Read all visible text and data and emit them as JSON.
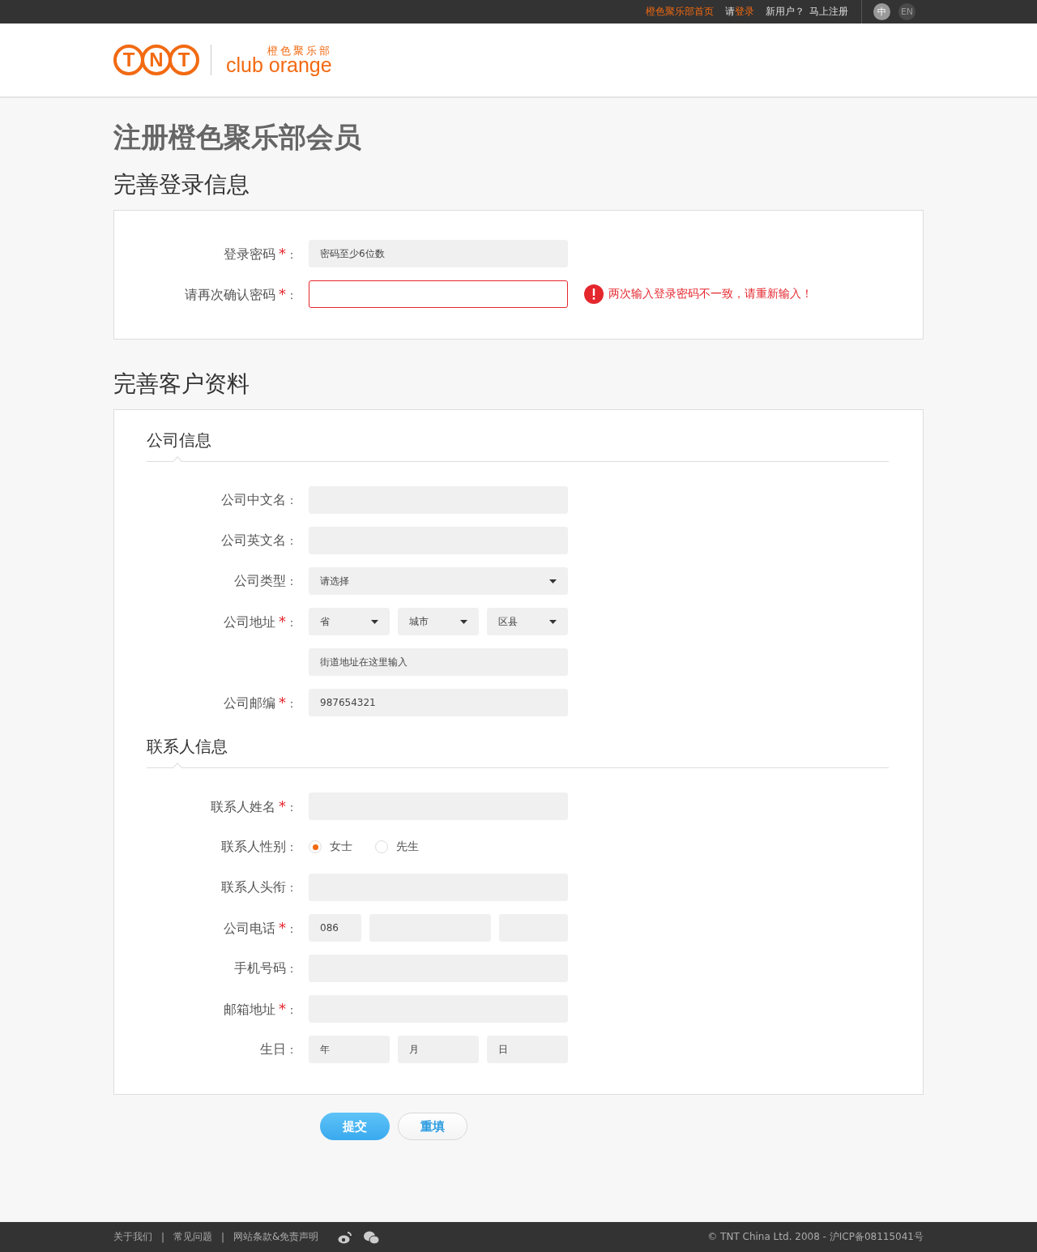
{
  "top_bar": {
    "home_link": "橙色聚乐部首页",
    "login_prompt": "请",
    "login_link": "登录",
    "new_user": "新用户？",
    "register_link": "马上注册",
    "languages": [
      {
        "label": "中",
        "selected": true
      },
      {
        "label": "EN",
        "selected": false
      }
    ]
  },
  "logo": {
    "letters": [
      "T",
      "N",
      "T"
    ],
    "club_cn": "橙色聚乐部",
    "club_en": "club orange"
  },
  "page_title": "注册橙色聚乐部会员",
  "form": {
    "required_mark": "*",
    "colon": "："
  },
  "sections": [
    {
      "title": "完善登录信息",
      "groups": [
        {
          "rows": [
            {
              "kind": "text",
              "label": "登录密码",
              "required": true,
              "fields": [
                {
                  "kind": "text",
                  "placeholder": "密码至少6位数",
                  "invalid": false
                }
              ]
            },
            {
              "kind": "text",
              "label": "请再次确认密码",
              "required": true,
              "fields": [
                {
                  "kind": "text",
                  "invalid": true
                }
              ],
              "error": "两次输入登录密码不一致，请重新输入！"
            }
          ]
        }
      ]
    },
    {
      "title": "完善客户资料",
      "groups": [
        {
          "title": "公司信息",
          "rows": [
            {
              "kind": "text",
              "label": "公司中文名",
              "required": false,
              "fields": [
                {
                  "kind": "text",
                  "invalid": false
                }
              ]
            },
            {
              "kind": "text",
              "label": "公司英文名",
              "required": false,
              "fields": [
                {
                  "kind": "text",
                  "invalid": false
                }
              ]
            },
            {
              "kind": "text",
              "label": "公司类型",
              "required": false,
              "fields": [
                {
                  "kind": "select",
                  "placeholder": "请选择",
                  "invalid": false
                }
              ]
            },
            {
              "kind": "triple",
              "label": "公司地址",
              "required": true,
              "fields": [
                {
                  "kind": "select",
                  "placeholder": "省",
                  "invalid": false
                },
                {
                  "kind": "select",
                  "placeholder": "城市",
                  "invalid": false
                },
                {
                  "kind": "select",
                  "placeholder": "区县",
                  "invalid": false
                }
              ]
            },
            {
              "kind": "text",
              "required": false,
              "fields": [
                {
                  "kind": "text",
                  "placeholder": "街道地址在这里输入",
                  "invalid": false
                }
              ]
            },
            {
              "kind": "text",
              "label": "公司邮编",
              "required": true,
              "fields": [
                {
                  "kind": "text",
                  "placeholder": "987654321",
                  "invalid": false
                }
              ]
            }
          ]
        },
        {
          "title": "联系人信息",
          "rows": [
            {
              "kind": "text",
              "label": "联系人姓名",
              "required": true,
              "fields": [
                {
                  "kind": "text",
                  "invalid": false
                }
              ]
            },
            {
              "kind": "radio",
              "label": "联系人性别",
              "required": false,
              "options": [
                {
                  "label": "女士",
                  "selected": true
                },
                {
                  "label": "先生",
                  "selected": false
                }
              ]
            },
            {
              "kind": "text",
              "label": "联系人头衔",
              "required": false,
              "fields": [
                {
                  "kind": "text",
                  "invalid": false
                }
              ]
            },
            {
              "kind": "phone",
              "label": "公司电话",
              "required": true,
              "fields": [
                {
                  "kind": "text",
                  "placeholder": "086",
                  "invalid": false
                },
                {
                  "kind": "text",
                  "invalid": false
                },
                {
                  "kind": "text",
                  "invalid": false
                }
              ]
            },
            {
              "kind": "text",
              "label": "手机号码",
              "required": false,
              "fields": [
                {
                  "kind": "text",
                  "invalid": false
                }
              ]
            },
            {
              "kind": "text",
              "label": "邮箱地址",
              "required": true,
              "fields": [
                {
                  "kind": "text",
                  "invalid": false
                }
              ]
            },
            {
              "kind": "triple",
              "label": "生日",
              "required": false,
              "fields": [
                {
                  "kind": "text",
                  "placeholder": "年",
                  "invalid": false
                },
                {
                  "kind": "text",
                  "placeholder": "月",
                  "invalid": false
                },
                {
                  "kind": "text",
                  "placeholder": "日",
                  "invalid": false
                }
              ]
            }
          ]
        }
      ]
    }
  ],
  "buttons": [
    {
      "label": "提交",
      "kind": "primary"
    },
    {
      "label": "重填",
      "kind": "secondary"
    }
  ],
  "footer": {
    "links": [
      "关于我们",
      "常见问题",
      "网站条款&免责声明"
    ],
    "separator": "|",
    "copyright": "© TNT China Ltd. 2008 - 沪ICP备08115041号"
  }
}
